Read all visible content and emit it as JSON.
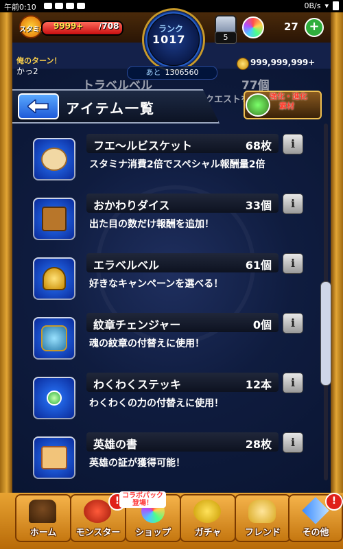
{
  "status_bar": {
    "time": "午前0:10",
    "network": "0B/s"
  },
  "hud": {
    "stamina_label": "スタミナ",
    "stamina_value": "9999+",
    "stamina_max": "/708",
    "stamina_fill_fraction": 1.0,
    "rank_label": "ランク",
    "rank_value": "1017",
    "next_exp_label": "あと",
    "next_exp_value": "1306560",
    "stone_count": "5",
    "gem_count": "27",
    "gem_add_label": "+",
    "turn_label": "俺のターン！",
    "turn_name": "かっ2",
    "gold_value": "999,999,999+"
  },
  "header": {
    "title": "アイテム一覧",
    "back_label": "⇦",
    "evo_text_line1": "強化・進化",
    "evo_text_line2": "素材",
    "behind_item_name": "トラベルベル",
    "behind_item_count": "77個",
    "behind_item_desc": "好きなクエストを"
  },
  "items": [
    {
      "name": "フエ〜ルビスケット",
      "count": "68枚",
      "desc": "スタミナ消費2倍でスペシャル報酬量2倍",
      "icon": "biscuit-icon"
    },
    {
      "name": "おかわりダイス",
      "count": "33個",
      "desc": "出た目の数だけ報酬を追加！",
      "icon": "dice-icon"
    },
    {
      "name": "エラベルベル",
      "count": "61個",
      "desc": "好きなキャンペーンを選べる！",
      "icon": "bell-icon"
    },
    {
      "name": "紋章チェンジャー",
      "count": "0個",
      "desc": "魂の紋章の付替えに使用！",
      "icon": "emblem-changer-icon"
    },
    {
      "name": "わくわくステッキ",
      "count": "12本",
      "desc": "わくわくの力の付替えに使用！",
      "icon": "stick-icon"
    },
    {
      "name": "英雄の書",
      "count": "28枚",
      "desc": "英雄の証が獲得可能！",
      "icon": "scroll-icon"
    }
  ],
  "nav": {
    "home": "ホーム",
    "monster": "モンスター",
    "shop": "ショップ",
    "gacha": "ガチャ",
    "friend": "フレンド",
    "more": "その他",
    "alert": "!",
    "collab_tag_line1": "コラボパック",
    "collab_tag_line2": "登場！"
  },
  "info_label": "i"
}
